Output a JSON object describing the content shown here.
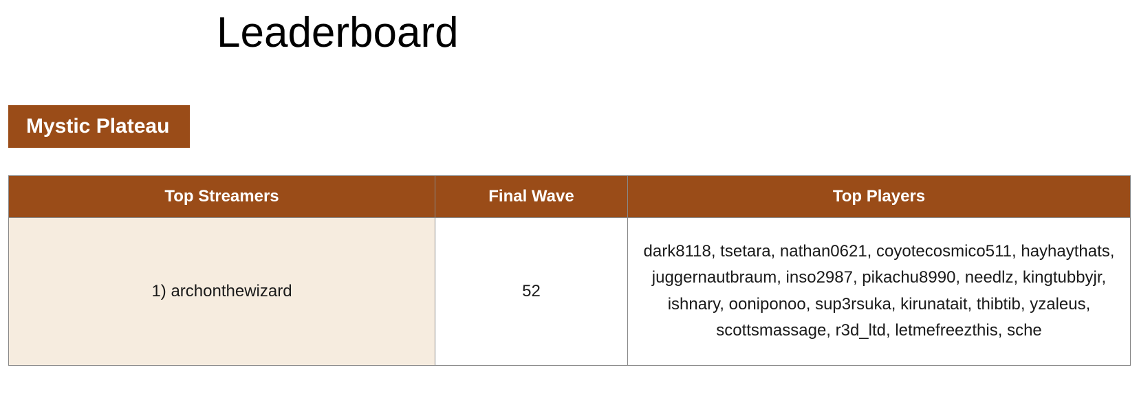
{
  "title": "Leaderboard",
  "section": {
    "name": "Mystic Plateau"
  },
  "table": {
    "headers": {
      "streamers": "Top Streamers",
      "wave": "Final Wave",
      "players": "Top Players"
    },
    "rows": [
      {
        "streamer": "1) archonthewizard",
        "wave": "52",
        "players": "dark8118, tsetara, nathan0621, coyotecosmico511, hayhaythats, juggernautbraum, inso2987, pikachu8990, needlz, kingtubbyjr, ishnary, ooniponoo, sup3rsuka, kirunatait, thibtib, yzaleus, scottsmassage, r3d_ltd, letmefreezthis, sche"
      }
    ]
  }
}
